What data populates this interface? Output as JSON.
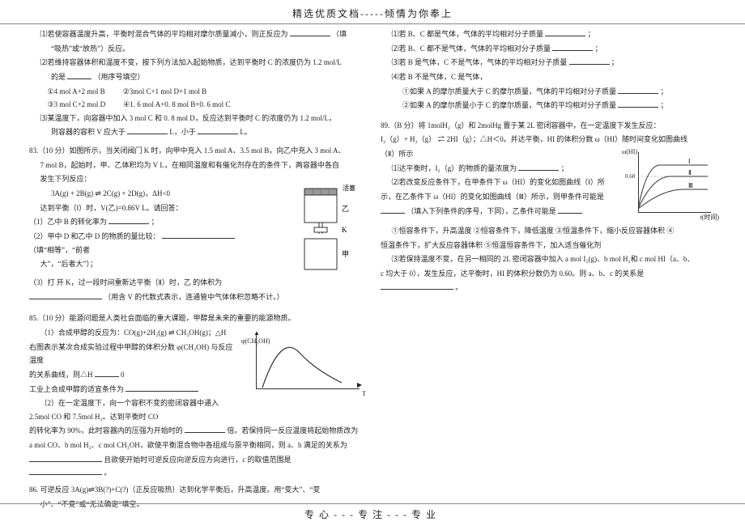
{
  "header": "精选优质文档-----倾情为你奉上",
  "footer": "专心---专注---专业",
  "left": {
    "l1": "⑴若使容器温度升高，平衡时混合气体的平均相对摩尔质量减小，则正反应为",
    "l1b": "（填",
    "l2": "“吸热”或“放热”）反应。",
    "l3": "⑵若维持容器体积和温度不变，按下列方法加入起始物质，达到平衡时 C 的浓度仍为 1.2 mol/L",
    "l4": "的是",
    "l4b": "（用序号填空）",
    "optA": "①4 mol A+2 mol B",
    "optB": "②3mol C+1 mol D+1 mol B",
    "optC": "③3 mol C+2 mol D",
    "optD": "④1. 6 mol A+0. 8 mol B+0. 6 mol C",
    "l5": "⑶某温度下，向容器中加入 3 mol C 和 0. 8 mol D，反应达到平衡时 C 的浓度仍为 1.2 mol/L，",
    "l6": "则容器的容积 V 应大于",
    "l6b": "L，小于",
    "l6c": "L。",
    "q83": "83.（10 分）如图所示，当关闭阀门 K 时，向甲中充入 1.5 mol A、3.5 mol B，向乙中充入 3 mol A、",
    "q83b": "7 mol B，起始时，甲、乙体积均为 V L，在相同温度和有催化剂存在的条件下，两容器中各自",
    "q83c": "发生下列反应：",
    "eq83": "3A(g) + 2B(g) ⇌ 2C(g) + 2D(g)，ΔH<0",
    "q83d": "达到平衡（Ⅰ）时，V(乙)=0.86V L。请回答：",
    "q83e": "（1）乙中 B 的转化率为",
    "q83e2": "；",
    "q83f": "（2）甲中 D 和乙中 D 的物质的量比较：",
    "q83f2": "（填“相等”，“前者",
    "q83g": "大”，“后者大”）；",
    "q83h": "（3）打 开 K，过一段时间重新达平衡（Ⅱ）时，乙 的体积为",
    "q83i": "（用含 V 的代数式表示，连通管中气体体积忽略不计。）",
    "q85": "85.（10 分）能源问题是人类社会面临的重大课题，甲醇是未来的重要的能源物质。",
    "q85a": "（1）合成甲醇的反应为：CO(g)+2H₂(g) ⇌ CH₃OH(g)；△H",
    "q85b": "右图表示某次合成实验过程中甲醇的体积分数 φ(CH₃OH) 与反应温度",
    "q85c": "的关系曲线，则△H",
    "q85c2": "0",
    "q85d": "工业上合成甲醇的适宜条件为",
    "q85e": "（2）在一定温度下，向一个容积不变的密闭容器中通入 2.5mol CO 和 7.5mol H₂。达到平衡时 CO",
    "q85f": "的转化率为 90%，此时容器内的压强为开始时的",
    "q85f2": "倍。若保持同一反应温度将起始物质改为",
    "q85g": "a mol CO、b mol H₂、c mol CH₃OH，欲使平衡混合物中各组成与原平衡相同，则 a、b 满足的关系为",
    "q85h": "且欲使开始时可逆反应向逆反应方向进行，c 的取值范围是",
    "q85h2": "。",
    "q86": "86. 可逆反应 3A(g)⇌3B(?)+C(?)（正反应吸热）达到化学平衡后，升高温度。用“变大”、“变",
    "q86b": "小”、“不变”或“无法确定”填空。",
    "ylabel_curve": "φ(CH₃OH)",
    "xlabel_curve": "T",
    "app_label_top": "活塞",
    "app_label_yi": "乙",
    "app_label_k": "K",
    "app_label_jia": "甲"
  },
  "right": {
    "r1": "⑴若 B、C 都是气体，气体的平均相对分子质量",
    "r1b": "；",
    "r2": "⑵若 B、C 都不是气体，气体的平均相对分子质量",
    "r2b": "；",
    "r3": "⑶若 B 是气体，C 不是气体，气体的平均相对分子质量",
    "r3b": "；",
    "r4": "⑷若 B 不是气体，C 是气体，",
    "r5": "①如果 A 的摩尔质量大于 C 的摩尔质量，气体的平均相对分子质量",
    "r5b": "；",
    "r6": "②如果 A 的摩尔质量小于 C 的摩尔质量，气体的平均相对分子质量",
    "r6b": "；",
    "q89": "89.（B 分）将 1molH₂（g）和 2molHg 置于某 2L 密闭容器中，在一定温度下发生反应：",
    "q89eq": "I₂（g）+ H₂（g） ⇌ 2HI（g）；△H＜0。并达平衡，HI 的体积分数 ω（HI）随时间变化如图曲线",
    "q89b": "（Ⅱ）所示",
    "q89c": "⑴达平衡时，I₂（g）的物质的量浓度为",
    "q89c2": "；",
    "q89d": "⑵若改变反应条件下，在甲条件下 ω（HI）的变化如图曲线（Ⅰ）所",
    "q89e": "示，在乙条件下 ω（HI）的变化如图曲线（Ⅲ）所示，则甲条件可能是",
    "q89f": "（填入下列条件的序号，下同），乙条件可能是",
    "q89opt1": "①恒容条件下，升高温度  ②恒容条件下，降低温度  ③恒温条件下，缩小反应容器体积  ④",
    "q89opt2": "恒温条件下，扩大反应容器体积  ⑤恒温恒容条件下，加入适当催化剂",
    "q89g": "⑶若保持温度不变，在另一相同的 2L 密闭容器中加入 a mol I₂(g)、b mol H₂和 c mol HI（a、b、",
    "q89h": "c 均大于 0），发生反应，达平衡时，HI 的体积分数仍为 0.60。则 a、b、c 的关系是",
    "q89h2": "。",
    "chart2_ylabel": "ω(HI)",
    "chart2_xlabel": "t(时间)",
    "chart2_val": "0.60",
    "chart2_l1": "Ⅰ",
    "chart2_l2": "Ⅱ",
    "chart2_l3": "Ⅲ"
  }
}
